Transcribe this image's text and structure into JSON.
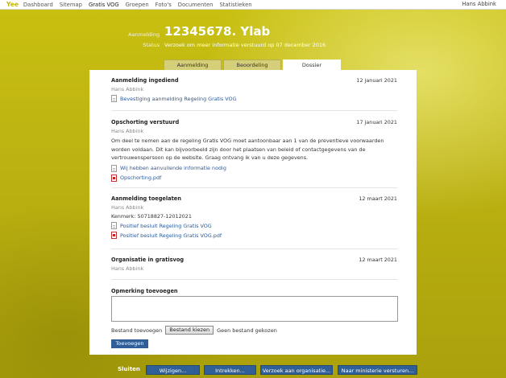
{
  "topbar": {
    "logo": "Yee",
    "nav": [
      "Dashboard",
      "Sitemap",
      "Gratis VOG",
      "Groepen",
      "Foto's",
      "Documenten",
      "Statistieken"
    ],
    "user": "Hans Abbink"
  },
  "header": {
    "aanmelding_label": "Aanmelding",
    "title": "12345678. Ylab",
    "status_label": "Status",
    "status_value": "Verzoek om meer informatie verstuurd op 07 december 2016"
  },
  "tabs": [
    "Aanmelding",
    "Beoordeling",
    "Dossier"
  ],
  "active_tab": "Dossier",
  "entries": [
    {
      "title": "Aanmelding ingediend",
      "date": "12 januari 2021",
      "author": "Hans Abbink",
      "attachments": [
        {
          "label": "Bevestiging aanmelding Regeling Gratis VOG",
          "icon": "document-icon"
        }
      ]
    },
    {
      "title": "Opschorting verstuurd",
      "date": "17 januari 2021",
      "author": "Hans Abbink",
      "text": "Om deel te nemen aan de regeling Gratis VOG moet aantoonbaar aan 1 van de preventieve voorwaarden worden voldaan. Dit kan bijvoorbeeld zijn door het plaatsen van beleid of contactgegevens van de vertrouwenspersoon op de website. Graag ontvang ik van u deze gegevens.",
      "attachments": [
        {
          "label": "Wij hebben aanvullende informatie nodig",
          "icon": "document-icon"
        },
        {
          "label": "Opschorting.pdf",
          "icon": "pdf-icon"
        }
      ]
    },
    {
      "title": "Aanmelding toegelaten",
      "date": "12 maart 2021",
      "author": "Hans Abbink",
      "line": "Kenmerk: 50718827-12012021",
      "attachments": [
        {
          "label": "Positief besluit Regeling Gratis VOG",
          "icon": "document-icon"
        },
        {
          "label": "Positief besluit Regeling Gratis VOG.pdf",
          "icon": "pdf-icon"
        }
      ]
    },
    {
      "title": "Organisatie in gratisvog",
      "date": "12 maart 2021",
      "author": "Hans Abbink"
    }
  ],
  "comment": {
    "label": "Opmerking toevoegen",
    "value": "",
    "file_label": "Bestand toevoegen",
    "file_button": "Bestand kiezen",
    "file_status": "Geen bestand gekozen",
    "submit": "Toevoegen"
  },
  "actions": {
    "close": "Sluiten",
    "buttons": [
      "Wijzigen...",
      "Intrekken...",
      "Verzoek aan organisatie...",
      "Naar ministerie versturen..."
    ]
  },
  "colors": {
    "background": "#bdb312",
    "button": "#2f5f96",
    "link": "#2a5a9a"
  }
}
